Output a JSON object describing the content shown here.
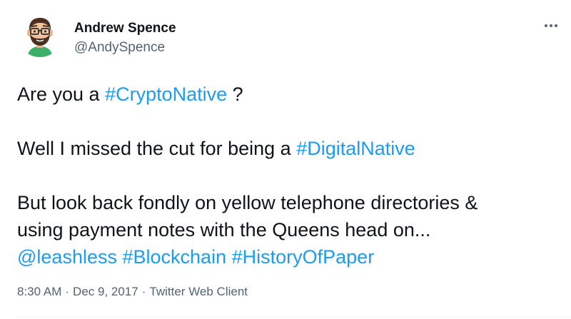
{
  "author": {
    "display_name": "Andrew Spence",
    "handle": "@AndySpence"
  },
  "tweet": {
    "line1": {
      "before": "Are you a ",
      "hashtag": "#CryptoNative",
      "after": " ?"
    },
    "line2": {
      "before": "Well I missed the cut for being a ",
      "hashtag": "#DigitalNative"
    },
    "line3": "But look back fondly on yellow telephone directories &",
    "line4": "using payment notes with the Queens head on...",
    "line5": {
      "mention": "@leashless",
      "hashtag1": "#Blockchain",
      "hashtag2": "#HistoryOfPaper"
    }
  },
  "meta": {
    "time": "8:30 AM",
    "separator": "·",
    "date": "Dec 9, 2017",
    "client": "Twitter Web Client"
  },
  "icons": {
    "more": "more-options-icon"
  },
  "colors": {
    "link": "#1d9bf0",
    "secondary_text": "#536471",
    "primary_text": "#0f1419",
    "avatar_bg": "#ffffff",
    "avatar_shirt": "#3cb06a"
  }
}
